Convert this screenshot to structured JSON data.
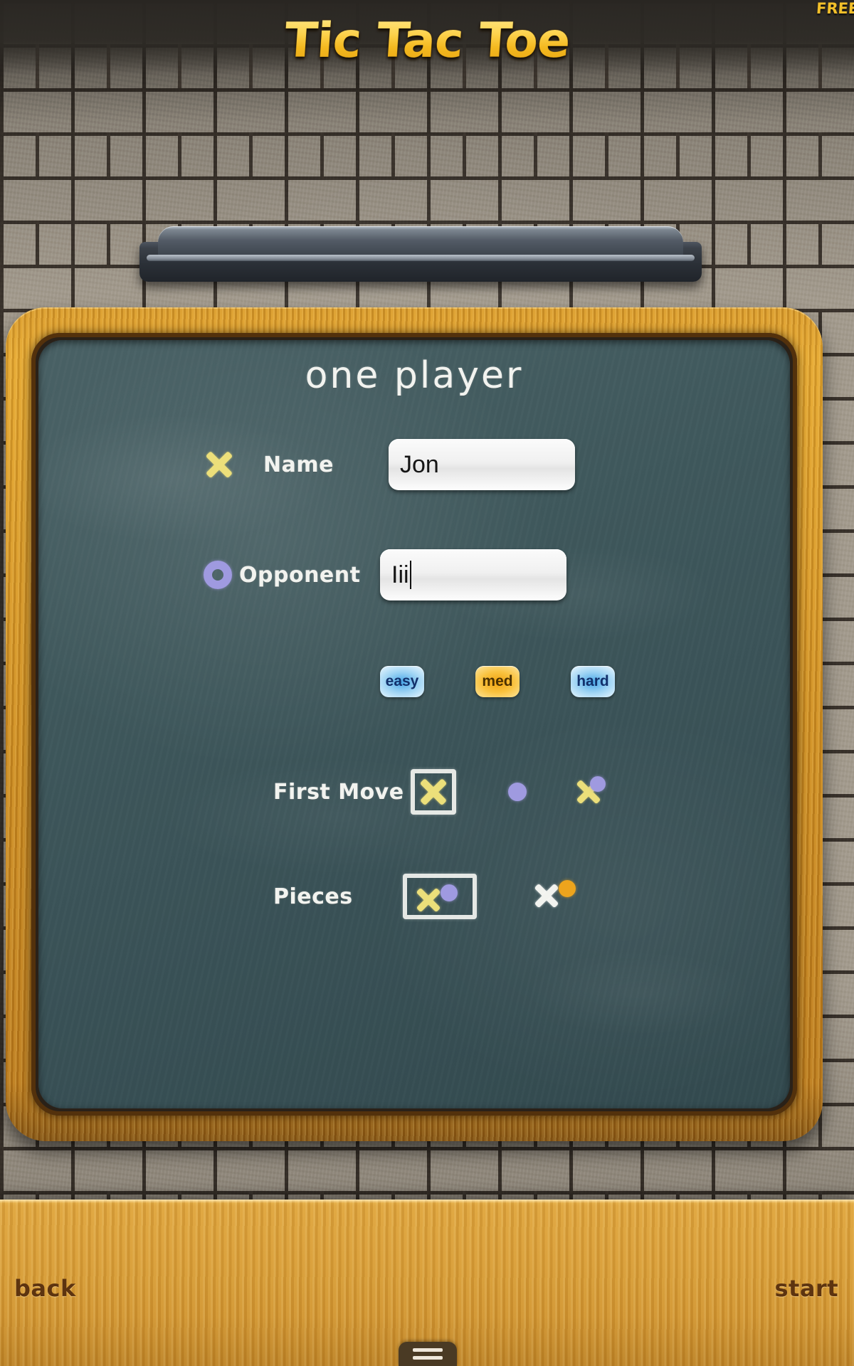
{
  "app": {
    "title": "Tic Tac Toe",
    "badge": "FREE"
  },
  "screen": {
    "heading": "one player"
  },
  "form": {
    "name_row": {
      "icon": "chalk-x-icon",
      "label": "Name",
      "value": "Jon",
      "placeholder": "Name"
    },
    "opponent_row": {
      "icon": "chalk-o-icon",
      "label": "Opponent",
      "value": "Iii",
      "placeholder": "Opponent"
    }
  },
  "difficulty": {
    "selected": "med",
    "options": [
      {
        "id": "easy",
        "label": "easy",
        "style": "blue"
      },
      {
        "id": "med",
        "label": "med",
        "style": "gold"
      },
      {
        "id": "hard",
        "label": "hard",
        "style": "blue"
      }
    ]
  },
  "first_move": {
    "label": "First Move",
    "selected": "x",
    "options": [
      {
        "id": "x",
        "icon": "chalk-x-icon"
      },
      {
        "id": "o",
        "icon": "chalk-o-icon"
      },
      {
        "id": "random",
        "icon": "chalk-xo-icon"
      }
    ]
  },
  "pieces": {
    "label": "Pieces",
    "selected": "yellow-purple",
    "options": [
      {
        "id": "yellow-purple",
        "icon": "pieces-yellow-purple-icon"
      },
      {
        "id": "white-orange",
        "icon": "pieces-white-orange-icon"
      }
    ]
  },
  "footer": {
    "back_label": "back",
    "start_label": "start"
  },
  "colors": {
    "title_gold": "#f6c635",
    "chalk_white": "#f2f3ef",
    "chalk_yellow": "#ecdf7a",
    "chalk_purple": "#9f9ae0",
    "chalk_orange": "#eda41d",
    "board_green": "#3f585c",
    "frame_wood": "#cf8f22",
    "shelf_wood": "#d79c36",
    "pill_blue": "#9fd4f4",
    "pill_gold": "#f9c341"
  }
}
